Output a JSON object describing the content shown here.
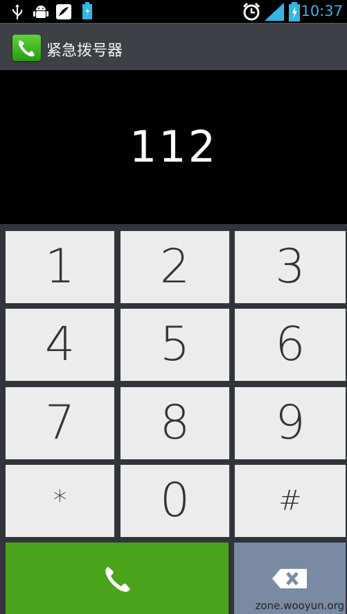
{
  "status_bar": {
    "time": "10:37",
    "icons": [
      "usb-icon",
      "android-debug-icon",
      "notification-icon",
      "battery-small-icon",
      "alarm-icon",
      "signal-icon",
      "battery-icon"
    ]
  },
  "action_bar": {
    "app_icon": "phone-icon",
    "title": "紧急拨号器"
  },
  "display": {
    "number": "112"
  },
  "keypad": {
    "keys": [
      "1",
      "2",
      "3",
      "4",
      "5",
      "6",
      "7",
      "8",
      "9",
      "*",
      "0",
      "#"
    ]
  },
  "actions": {
    "call_icon": "phone-icon",
    "backspace_icon": "backspace-icon"
  },
  "watermark": "zone.wooyun.org",
  "colors": {
    "call_green": "#4aa31a",
    "backspace_blue_gray": "#7a8aa3",
    "status_accent": "#33b5e5"
  }
}
